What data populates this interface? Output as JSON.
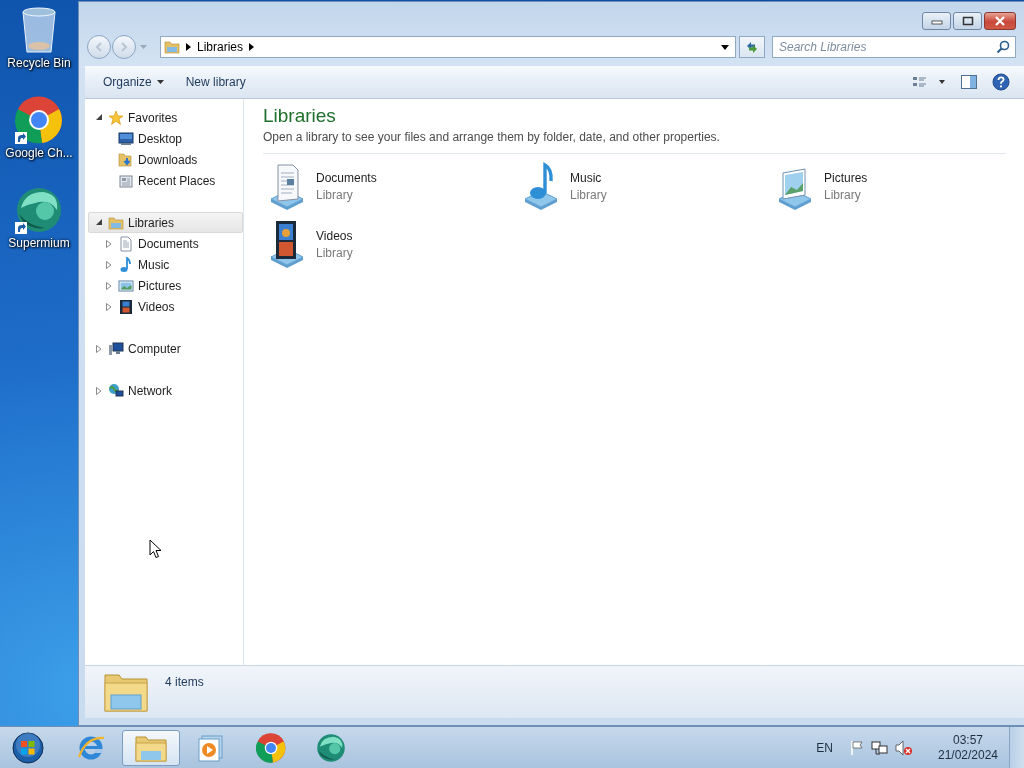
{
  "desktop_icons": [
    {
      "label": "Recycle Bin",
      "kind": "recycle",
      "shortcut": false
    },
    {
      "label": "Google Ch...",
      "kind": "chrome",
      "shortcut": true
    },
    {
      "label": "Supermium",
      "kind": "supermium",
      "shortcut": true
    }
  ],
  "window": {
    "address": {
      "crumbs": [
        "Libraries"
      ]
    },
    "search": {
      "placeholder": "Search Libraries"
    },
    "toolbar": [
      {
        "label": "Organize",
        "dropdown": true
      },
      {
        "label": "New library",
        "dropdown": false
      }
    ],
    "nav": [
      {
        "label": "Favorites",
        "kind": "star",
        "expanded": true,
        "selected": false,
        "children": [
          {
            "label": "Desktop",
            "kind": "desktop",
            "selected": false
          },
          {
            "label": "Downloads",
            "kind": "downloads",
            "selected": false
          },
          {
            "label": "Recent Places",
            "kind": "recent",
            "selected": false
          }
        ]
      },
      {
        "label": "Libraries",
        "kind": "libraries",
        "expanded": true,
        "selected": true,
        "children": [
          {
            "label": "Documents",
            "kind": "documents",
            "expanded": false,
            "selected": false
          },
          {
            "label": "Music",
            "kind": "music",
            "expanded": false,
            "selected": false
          },
          {
            "label": "Pictures",
            "kind": "pictures",
            "expanded": false,
            "selected": false
          },
          {
            "label": "Videos",
            "kind": "videos",
            "expanded": false,
            "selected": false
          }
        ]
      },
      {
        "label": "Computer",
        "kind": "computer",
        "expanded": false,
        "selected": false
      },
      {
        "label": "Network",
        "kind": "network",
        "expanded": false,
        "selected": false
      }
    ],
    "content": {
      "title": "Libraries",
      "description": "Open a library to see your files and arrange them by folder, date, and other properties.",
      "items": [
        {
          "name": "Documents",
          "subtitle": "Library",
          "kind": "documents"
        },
        {
          "name": "Music",
          "subtitle": "Library",
          "kind": "music"
        },
        {
          "name": "Pictures",
          "subtitle": "Library",
          "kind": "pictures"
        },
        {
          "name": "Videos",
          "subtitle": "Library",
          "kind": "videos"
        }
      ]
    },
    "status": {
      "text": "4 items"
    }
  },
  "taskbar": {
    "apps": [
      {
        "kind": "ie",
        "selected": false
      },
      {
        "kind": "explorer",
        "selected": true
      },
      {
        "kind": "media",
        "selected": false
      },
      {
        "kind": "chrome",
        "selected": false
      },
      {
        "kind": "supermium",
        "selected": false
      }
    ],
    "language": "EN",
    "tray": [
      {
        "kind": "flag"
      },
      {
        "kind": "network"
      },
      {
        "kind": "volume-muted"
      }
    ],
    "time": "03:57",
    "date": "21/02/2024"
  }
}
